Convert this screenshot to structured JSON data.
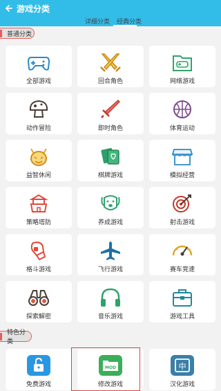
{
  "header": {
    "title": "游戏分类",
    "tabs": [
      "详细分类",
      "经典分类"
    ],
    "active_tab": 1,
    "color": "#32bde8"
  },
  "sections": {
    "normal": "普通分类",
    "special": "特色分类"
  },
  "categories": [
    {
      "label": "全部游戏",
      "icon": "gamepad-icon"
    },
    {
      "label": "回合角色",
      "icon": "crossed-swords-icon"
    },
    {
      "label": "网络游戏",
      "icon": "folder-gamepad-icon"
    },
    {
      "label": "动作冒险",
      "icon": "mushroom-icon"
    },
    {
      "label": "即时角色",
      "icon": "sword-icon"
    },
    {
      "label": "体育运动",
      "icon": "basketball-icon"
    },
    {
      "label": "益智休闲",
      "icon": "devil-icon"
    },
    {
      "label": "棋牌游戏",
      "icon": "cards-icon"
    },
    {
      "label": "模拟经营",
      "icon": "shop-icon"
    },
    {
      "label": "策略塔防",
      "icon": "tower-icon"
    },
    {
      "label": "养成游戏",
      "icon": "dog-icon"
    },
    {
      "label": "射击游戏",
      "icon": "target-icon"
    },
    {
      "label": "格斗游戏",
      "icon": "boxing-glove-icon"
    },
    {
      "label": "飞行游戏",
      "icon": "airplane-icon"
    },
    {
      "label": "赛车竞速",
      "icon": "speedometer-icon"
    },
    {
      "label": "探索解密",
      "icon": "binoculars-icon"
    },
    {
      "label": "音乐游戏",
      "icon": "headphones-icon"
    },
    {
      "label": "游戏工具",
      "icon": "toolbox-icon"
    }
  ],
  "special": [
    {
      "label": "免费游戏",
      "icon": "unlock-icon"
    },
    {
      "label": "修改游戏",
      "icon": "mod-folder-icon",
      "badge": "MOD"
    },
    {
      "label": "汉化游戏",
      "icon": "chinese-char-icon",
      "badge": "中"
    }
  ]
}
